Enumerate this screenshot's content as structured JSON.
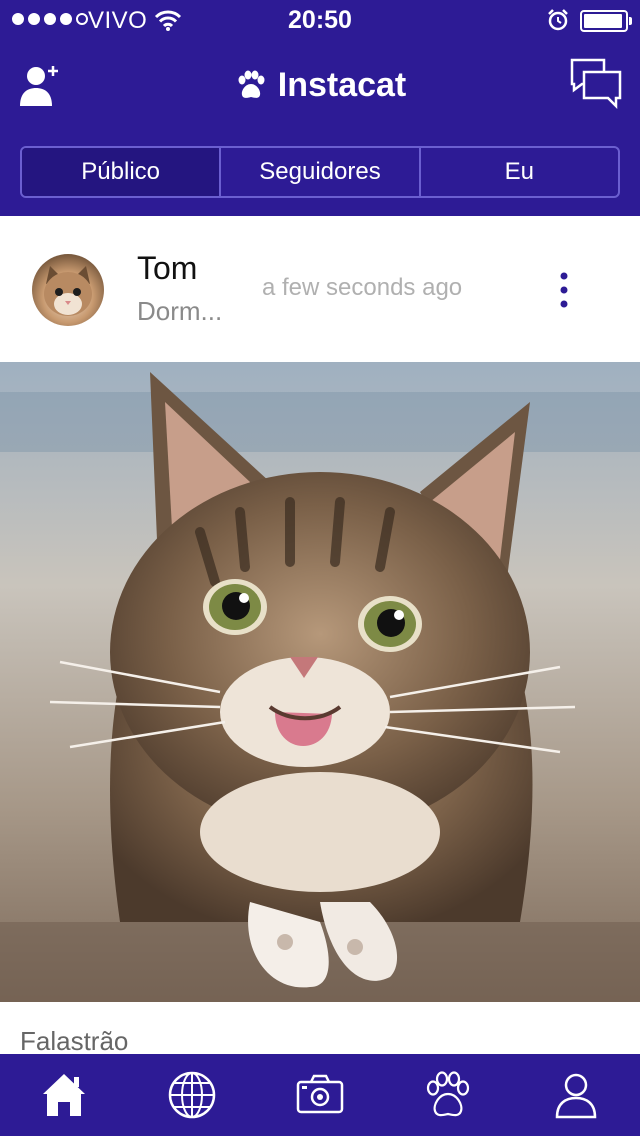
{
  "status_bar": {
    "carrier": "VIVO",
    "time": "20:50",
    "signal_filled": 4,
    "signal_total": 5,
    "battery_level": 0.95,
    "icons": [
      "signal-dots-icon",
      "wifi-icon",
      "alarm-clock-icon",
      "battery-icon"
    ]
  },
  "nav": {
    "title": "Instacat",
    "title_icon": "paw-icon",
    "left_icon": "add-user-icon",
    "right_icon": "chat-bubbles-icon"
  },
  "tabs": {
    "items": [
      {
        "label": "Público",
        "active": true
      },
      {
        "label": "Seguidores",
        "active": false
      },
      {
        "label": "Eu",
        "active": false
      }
    ]
  },
  "post": {
    "username": "Tom",
    "caption_preview": "Dorm...",
    "timestamp": "a few seconds ago",
    "caption": "Falastrão",
    "more_icon": "more-vertical-icon"
  },
  "tabbar": {
    "items": [
      {
        "icon": "home-icon",
        "active": true
      },
      {
        "icon": "globe-icon",
        "active": false
      },
      {
        "icon": "camera-icon",
        "active": false
      },
      {
        "icon": "paw-icon",
        "active": false
      },
      {
        "icon": "profile-icon",
        "active": false
      }
    ]
  },
  "colors": {
    "brand": "#2d1b95",
    "segment_active": "#241580",
    "muted_text": "#8a8a8a"
  }
}
